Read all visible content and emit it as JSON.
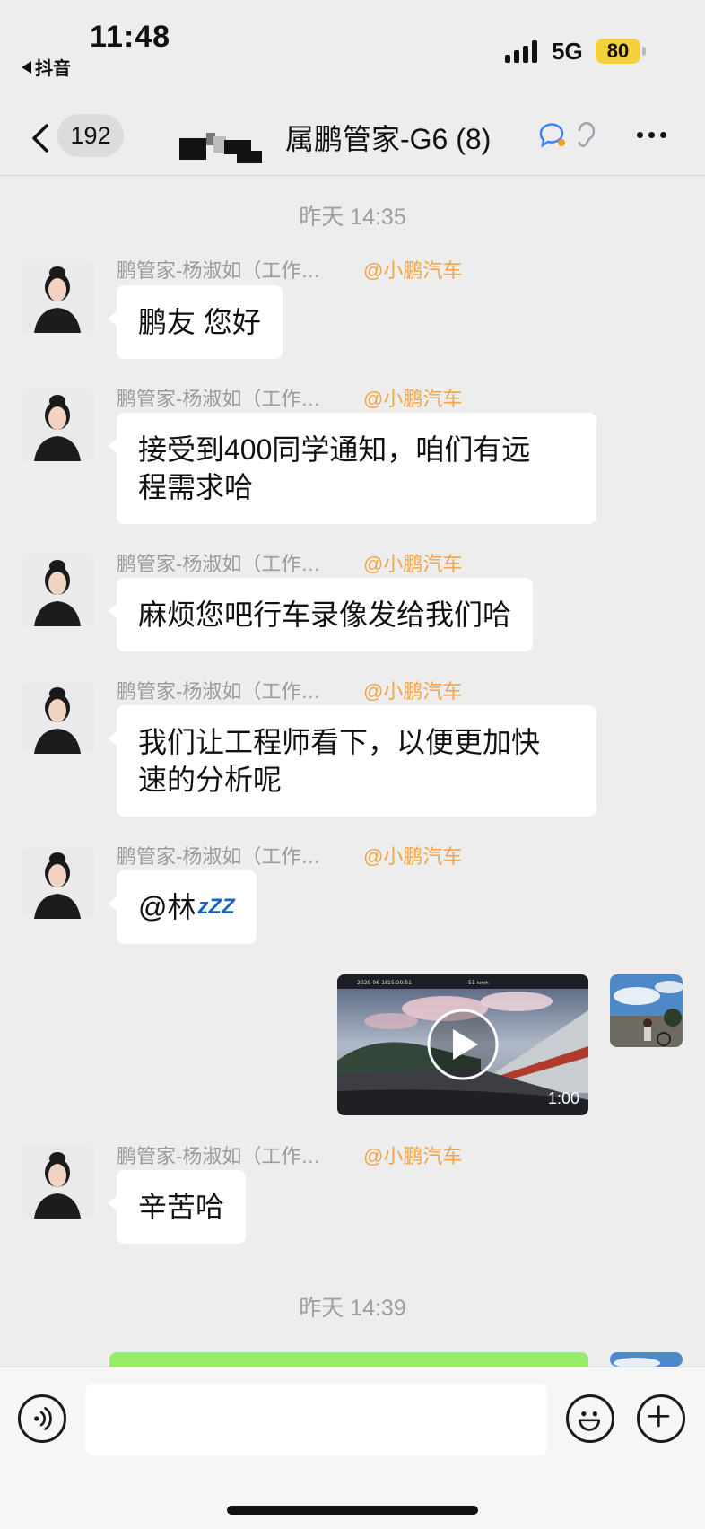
{
  "status_bar": {
    "time": "11:48",
    "back_app": "抖音",
    "network": "5G",
    "battery": "80"
  },
  "nav": {
    "unread_count": "192",
    "title": "属鹏管家-G6 (8)",
    "icons": [
      "chevron-left-icon",
      "chat-ai-icon",
      "ear-icon",
      "more-icon"
    ]
  },
  "conversation": {
    "timestamps": [
      "昨天 14:35",
      "昨天 14:39"
    ],
    "sender_name": "鹏管家-杨淑如（工作…",
    "sender_org": "@小鹏汽车",
    "messages": [
      {
        "text": "鹏友 您好"
      },
      {
        "text": "接受到400同学通知，咱们有远\n程需求哈"
      },
      {
        "text": "麻烦您吧行车录像发给我们哈"
      },
      {
        "text": "我们让工程师看下，以便更加快\n速的分析呢"
      },
      {
        "text": "@林",
        "suffix": "zZZ"
      },
      {
        "text": "辛苦哈"
      }
    ],
    "video": {
      "overlay_date": "2025-06-18",
      "overlay_time": "15:20:51",
      "overlay_speed": "51",
      "overlay_unit": "km/h",
      "duration": "1:00"
    }
  },
  "input": {
    "placeholder": ""
  },
  "colors": {
    "background": "#ededed",
    "bubble_incoming": "#ffffff",
    "bubble_outgoing": "#95ec69",
    "org_accent": "#f0a444",
    "sleep_accent": "#1565c0"
  }
}
